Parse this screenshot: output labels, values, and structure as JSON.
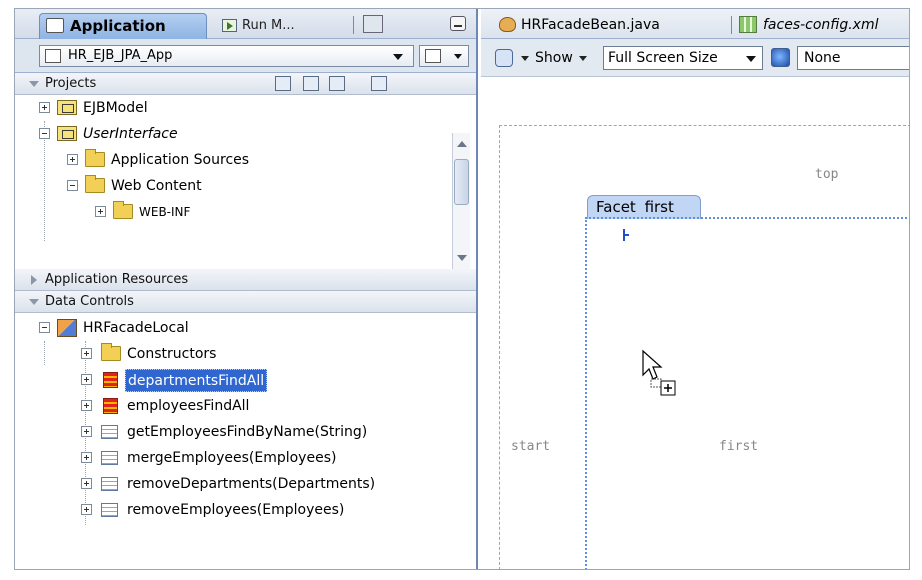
{
  "left_panel": {
    "tabs": {
      "application": "Application",
      "run": "Run M..."
    },
    "app_select": "HR_EJB_JPA_App",
    "projects": {
      "header": "Projects",
      "items": [
        {
          "label": "EJBModel"
        },
        {
          "label": "UserInterface"
        },
        {
          "label": "Application Sources"
        },
        {
          "label": "Web Content"
        },
        {
          "label": "WEB-INF"
        }
      ]
    },
    "app_resources": {
      "header": "Application Resources"
    },
    "data_controls": {
      "header": "Data Controls",
      "root": "HRFacadeLocal",
      "items": [
        {
          "label": "Constructors"
        },
        {
          "label": "departmentsFindAll"
        },
        {
          "label": "employeesFindAll"
        },
        {
          "label": "getEmployeesFindByName(String)"
        },
        {
          "label": "mergeEmployees(Employees)"
        },
        {
          "label": "removeDepartments(Departments)"
        },
        {
          "label": "removeEmployees(Employees)"
        }
      ]
    }
  },
  "editor": {
    "tabs": {
      "bean": "HRFacadeBean.java",
      "faces": "faces-config.xml"
    },
    "toolbar": {
      "show": "Show",
      "size": "Full Screen Size",
      "skin": "None"
    },
    "canvas": {
      "top": "top",
      "facet_tab": "Facet first",
      "start": "start",
      "first": "first"
    }
  },
  "icons": {
    "application_tab": "application-icon",
    "run_tab": "run-icon",
    "minimize": "minimize-icon",
    "folder": "folder-icon",
    "project": "project-icon",
    "data_control": "data-control-icon",
    "collection": "collection-icon",
    "method": "method-icon",
    "refresh": "refresh-icon",
    "globe": "globe-icon"
  },
  "colors": {
    "selection": "#2f66d0",
    "facet": "#c1d6f5",
    "panel_border": "#6f87b5"
  }
}
